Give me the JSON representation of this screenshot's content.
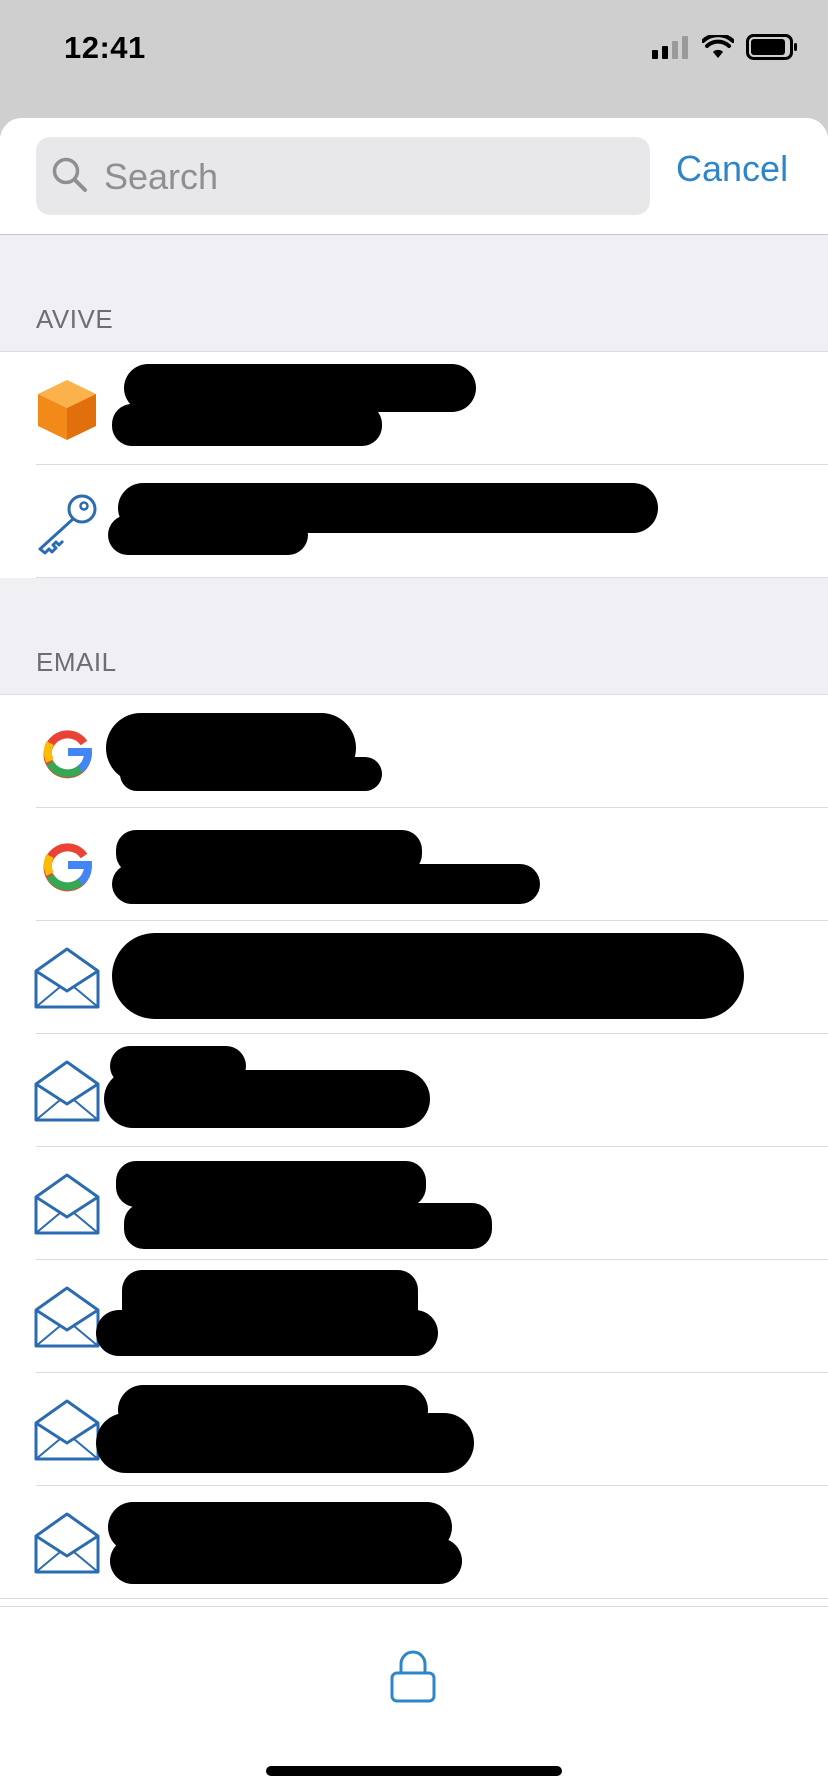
{
  "status_bar": {
    "time": "12:41"
  },
  "search": {
    "placeholder": "Search",
    "value": "",
    "cancel_label": "Cancel"
  },
  "colors": {
    "accent": "#2e86c9",
    "section_bg": "#efeff4",
    "icon_blue": "#2b6cb0",
    "orange": "#f28a1a"
  },
  "sections": [
    {
      "title": "AVIVE",
      "rows": [
        {
          "icon": "orange-cube-icon"
        },
        {
          "icon": "key-icon"
        }
      ]
    },
    {
      "title": "EMAIL",
      "rows": [
        {
          "icon": "google-icon"
        },
        {
          "icon": "google-icon"
        },
        {
          "icon": "envelope-icon"
        },
        {
          "icon": "envelope-icon"
        },
        {
          "icon": "envelope-icon"
        },
        {
          "icon": "envelope-icon"
        },
        {
          "icon": "envelope-icon"
        },
        {
          "icon": "envelope-icon"
        }
      ]
    }
  ],
  "tab_bar": {
    "icon": "lock-icon"
  }
}
